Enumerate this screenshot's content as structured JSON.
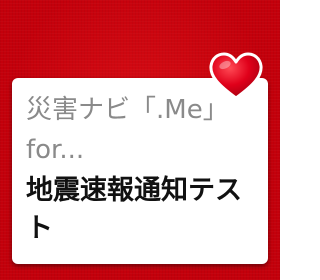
{
  "widget": {
    "app_name": "災害ナビ「.Me」for...",
    "message": "地震速報通知テスト"
  },
  "icons": {
    "heart": "heart-icon"
  },
  "colors": {
    "background": "#c4000b",
    "card": "#ffffff",
    "app_name_text": "#8a8a8a",
    "message_text": "#111111",
    "heart": "#e0001a"
  }
}
